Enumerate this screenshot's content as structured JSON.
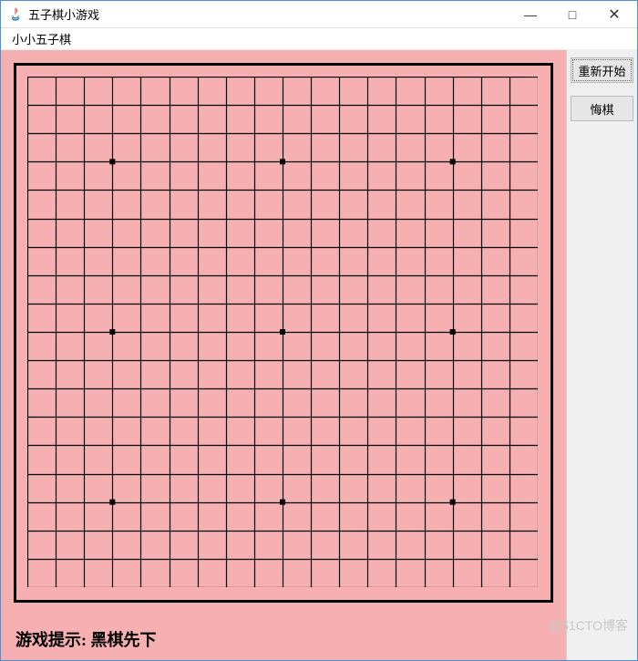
{
  "window": {
    "title": "五子棋小游戏",
    "controls": {
      "minimize": "—",
      "maximize": "□",
      "close": "✕"
    }
  },
  "menubar": {
    "item1": "小小五子棋"
  },
  "board": {
    "lines": 19,
    "star_points": [
      {
        "col": 3,
        "row": 3
      },
      {
        "col": 9,
        "row": 3
      },
      {
        "col": 15,
        "row": 3
      },
      {
        "col": 3,
        "row": 9
      },
      {
        "col": 9,
        "row": 9
      },
      {
        "col": 15,
        "row": 9
      },
      {
        "col": 3,
        "row": 15
      },
      {
        "col": 9,
        "row": 15
      },
      {
        "col": 15,
        "row": 15
      }
    ],
    "stones": [],
    "color_background": "#f6b0b2",
    "color_line": "#000000"
  },
  "status": {
    "prefix": "游戏提示:",
    "message": "黑棋先下"
  },
  "buttons": {
    "restart": "重新开始",
    "undo": "悔棋"
  },
  "watermark": "@51CTO博客"
}
